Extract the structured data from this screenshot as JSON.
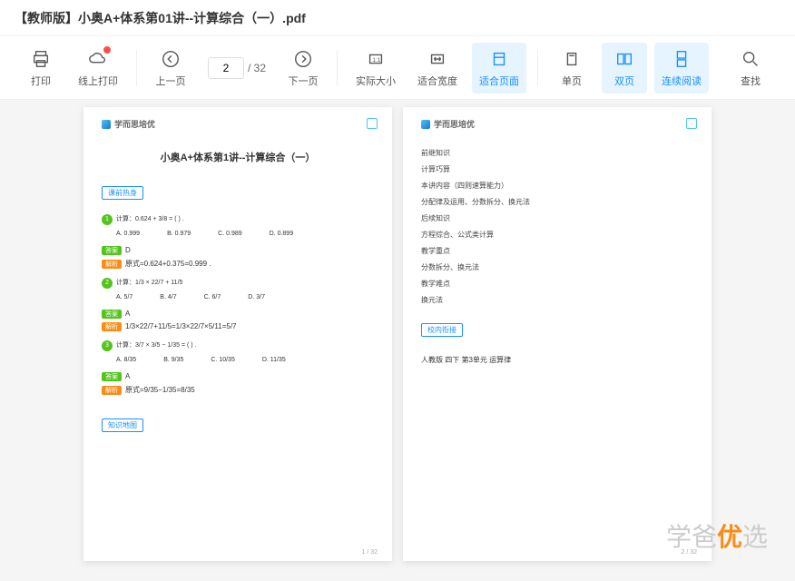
{
  "header": {
    "title": "【教师版】小奥A+体系第01讲--计算综合（一）.pdf"
  },
  "toolbar": {
    "print": "打印",
    "online_print": "线上打印",
    "prev": "上一页",
    "next": "下一页",
    "actual": "实际大小",
    "fit_width": "适合宽度",
    "fit_page": "适合页面",
    "single": "单页",
    "double": "双页",
    "continuous": "连续阅读",
    "search": "查找",
    "page_current": "2",
    "page_total": "/ 32"
  },
  "page1": {
    "brand": "学而思培优",
    "title": "小奥A+体系第1讲--计算综合（一）",
    "section1": "课前热身",
    "q1": {
      "num": "1",
      "text": "计算：0.624 + 3/8 = ( ) .",
      "a": "A. 0.999",
      "b": "B. 0.979",
      "c": "C. 0.989",
      "d": "D. 0.899"
    },
    "ans1": "答案",
    "ans1v": "D",
    "exp1": "解析",
    "exp1v": "原式=0.624+0.375=0.999 .",
    "q2": {
      "num": "2",
      "text": "计算：1/3 × 22/7 + 11/5",
      "a": "A. 5/7",
      "b": "B. 4/7",
      "c": "C. 6/7",
      "d": "D. 3/7"
    },
    "ans2": "答案",
    "ans2v": "A",
    "exp2": "解析",
    "exp2v": "1/3×22/7+11/5=1/3×22/7×5/11=5/7",
    "q3": {
      "num": "3",
      "text": "计算：3/7 × 3/5 − 1/35 = ( ) .",
      "a": "A. 8/35",
      "b": "B. 9/35",
      "c": "C. 10/35",
      "d": "D. 11/35"
    },
    "ans3": "答案",
    "ans3v": "A",
    "exp3": "解析",
    "exp3v": "原式=9/35−1/35=8/35",
    "section2": "知识地图",
    "pagenum": "1 / 32"
  },
  "page2": {
    "brand": "学而思培优",
    "k1": "前继知识",
    "k2": "计算巧算",
    "k3": "本讲内容（四则速算能力）",
    "k4": "分配律及运用、分数拆分、换元法",
    "k5": "后续知识",
    "k6": "方程综合、公式类计算",
    "k7": "教学重点",
    "k8": "分数拆分、换元法",
    "k9": "教学难点",
    "k10": "换元法",
    "section": "校内衔接",
    "line": "人教版 四下 第3单元 运算律",
    "pagenum": "2 / 32"
  },
  "watermark": {
    "a": "学爸",
    "b": "优",
    "c": "选"
  }
}
